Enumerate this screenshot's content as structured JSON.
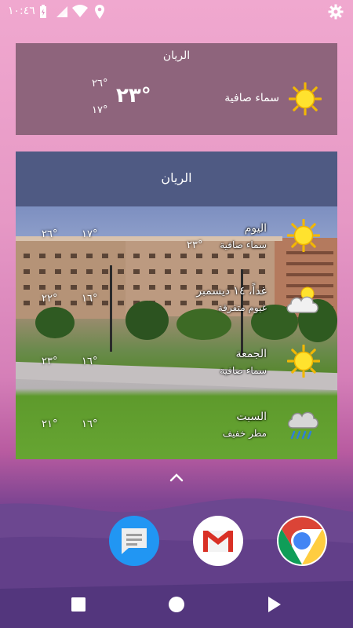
{
  "status_bar": {
    "time": "١٠:٤٦",
    "icons": [
      "battery-charging-icon",
      "signal-icon",
      "wifi-icon",
      "location-icon",
      "settings-gear-icon"
    ]
  },
  "widget_current": {
    "city": "الريان",
    "temperature": "٢٣°",
    "high": "٢٦°",
    "low": "١٧°",
    "condition": "سماء صافية",
    "icon": "sun-icon"
  },
  "widget_forecast": {
    "city": "الريان",
    "days": [
      {
        "day": "اليوم",
        "condition": "سماء صافية",
        "current": "٢٣°",
        "high": "٢٦°",
        "low": "١٧°",
        "icon": "sun-icon"
      },
      {
        "day": "غداً، ١٤ ديسمبر",
        "condition": "غيوم متفرقة",
        "high": "٢٢°",
        "low": "١٦°",
        "icon": "cloud-sun-icon"
      },
      {
        "day": "الجمعة",
        "condition": "سماء صافية",
        "high": "٢٣°",
        "low": "١٦°",
        "icon": "sun-icon"
      },
      {
        "day": "السبت",
        "condition": "مطر خفيف",
        "high": "٢١°",
        "low": "١٦°",
        "icon": "rain-cloud-icon"
      }
    ]
  },
  "dock": {
    "apps": [
      "messages-app-icon",
      "gmail-app-icon",
      "chrome-app-icon"
    ]
  },
  "colors": {
    "widget_current_bg": "#8e647c",
    "widget_forecast_header_bg": "#4f5a83"
  }
}
